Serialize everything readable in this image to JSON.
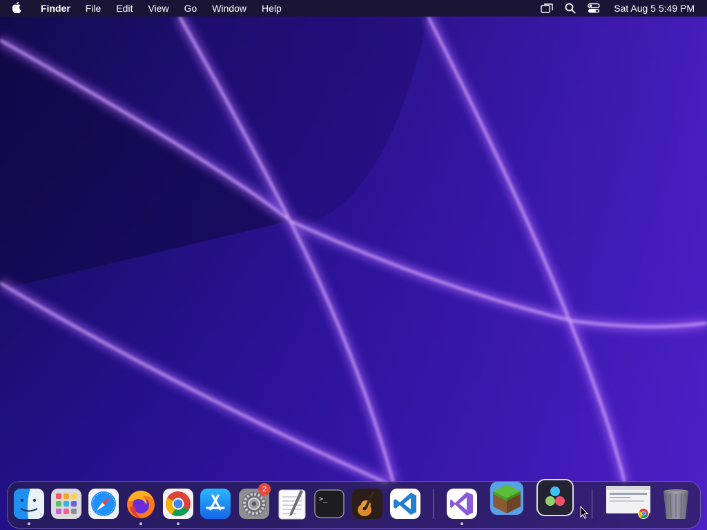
{
  "menubar": {
    "app_name": "Finder",
    "menus": [
      "File",
      "Edit",
      "View",
      "Go",
      "Window",
      "Help"
    ],
    "status_icons": [
      "screen-mirroring-icon",
      "spotlight-search-icon",
      "control-center-icon"
    ],
    "clock": "Sat Aug 5  5:49 PM"
  },
  "dock": {
    "apps": [
      {
        "name": "Finder",
        "icon": "finder-icon",
        "running": true
      },
      {
        "name": "Launchpad",
        "icon": "launchpad-icon",
        "running": false
      },
      {
        "name": "Safari",
        "icon": "safari-icon",
        "running": false
      },
      {
        "name": "Firefox",
        "icon": "firefox-icon",
        "running": true
      },
      {
        "name": "Google Chrome",
        "icon": "chrome-icon",
        "running": true
      },
      {
        "name": "App Store",
        "icon": "app-store-icon",
        "running": false
      },
      {
        "name": "System Settings",
        "icon": "system-settings-icon",
        "running": false,
        "badge": "2"
      },
      {
        "name": "TextEdit",
        "icon": "textedit-icon",
        "running": false
      },
      {
        "name": "Terminal",
        "icon": "terminal-icon",
        "running": false
      },
      {
        "name": "GarageBand",
        "icon": "garageband-icon",
        "running": false
      },
      {
        "name": "Visual Studio Code",
        "icon": "vscode-icon",
        "running": false
      },
      {
        "name": "Visual Studio",
        "icon": "visual-studio-icon",
        "running": true
      },
      {
        "name": "Minecraft",
        "icon": "minecraft-icon",
        "running": false
      },
      {
        "name": "DaVinci Resolve",
        "icon": "davinci-resolve-icon",
        "running": false
      }
    ],
    "minimized_window": "chrome-window-thumbnail",
    "trash": "trash-icon",
    "terminal_glyph": ">_"
  },
  "colors": {
    "wallpaper_base": "#1c0e6e",
    "wallpaper_glow": "#c07cff",
    "menubar_bg": "#1a1436",
    "badge": "#e8473d"
  }
}
